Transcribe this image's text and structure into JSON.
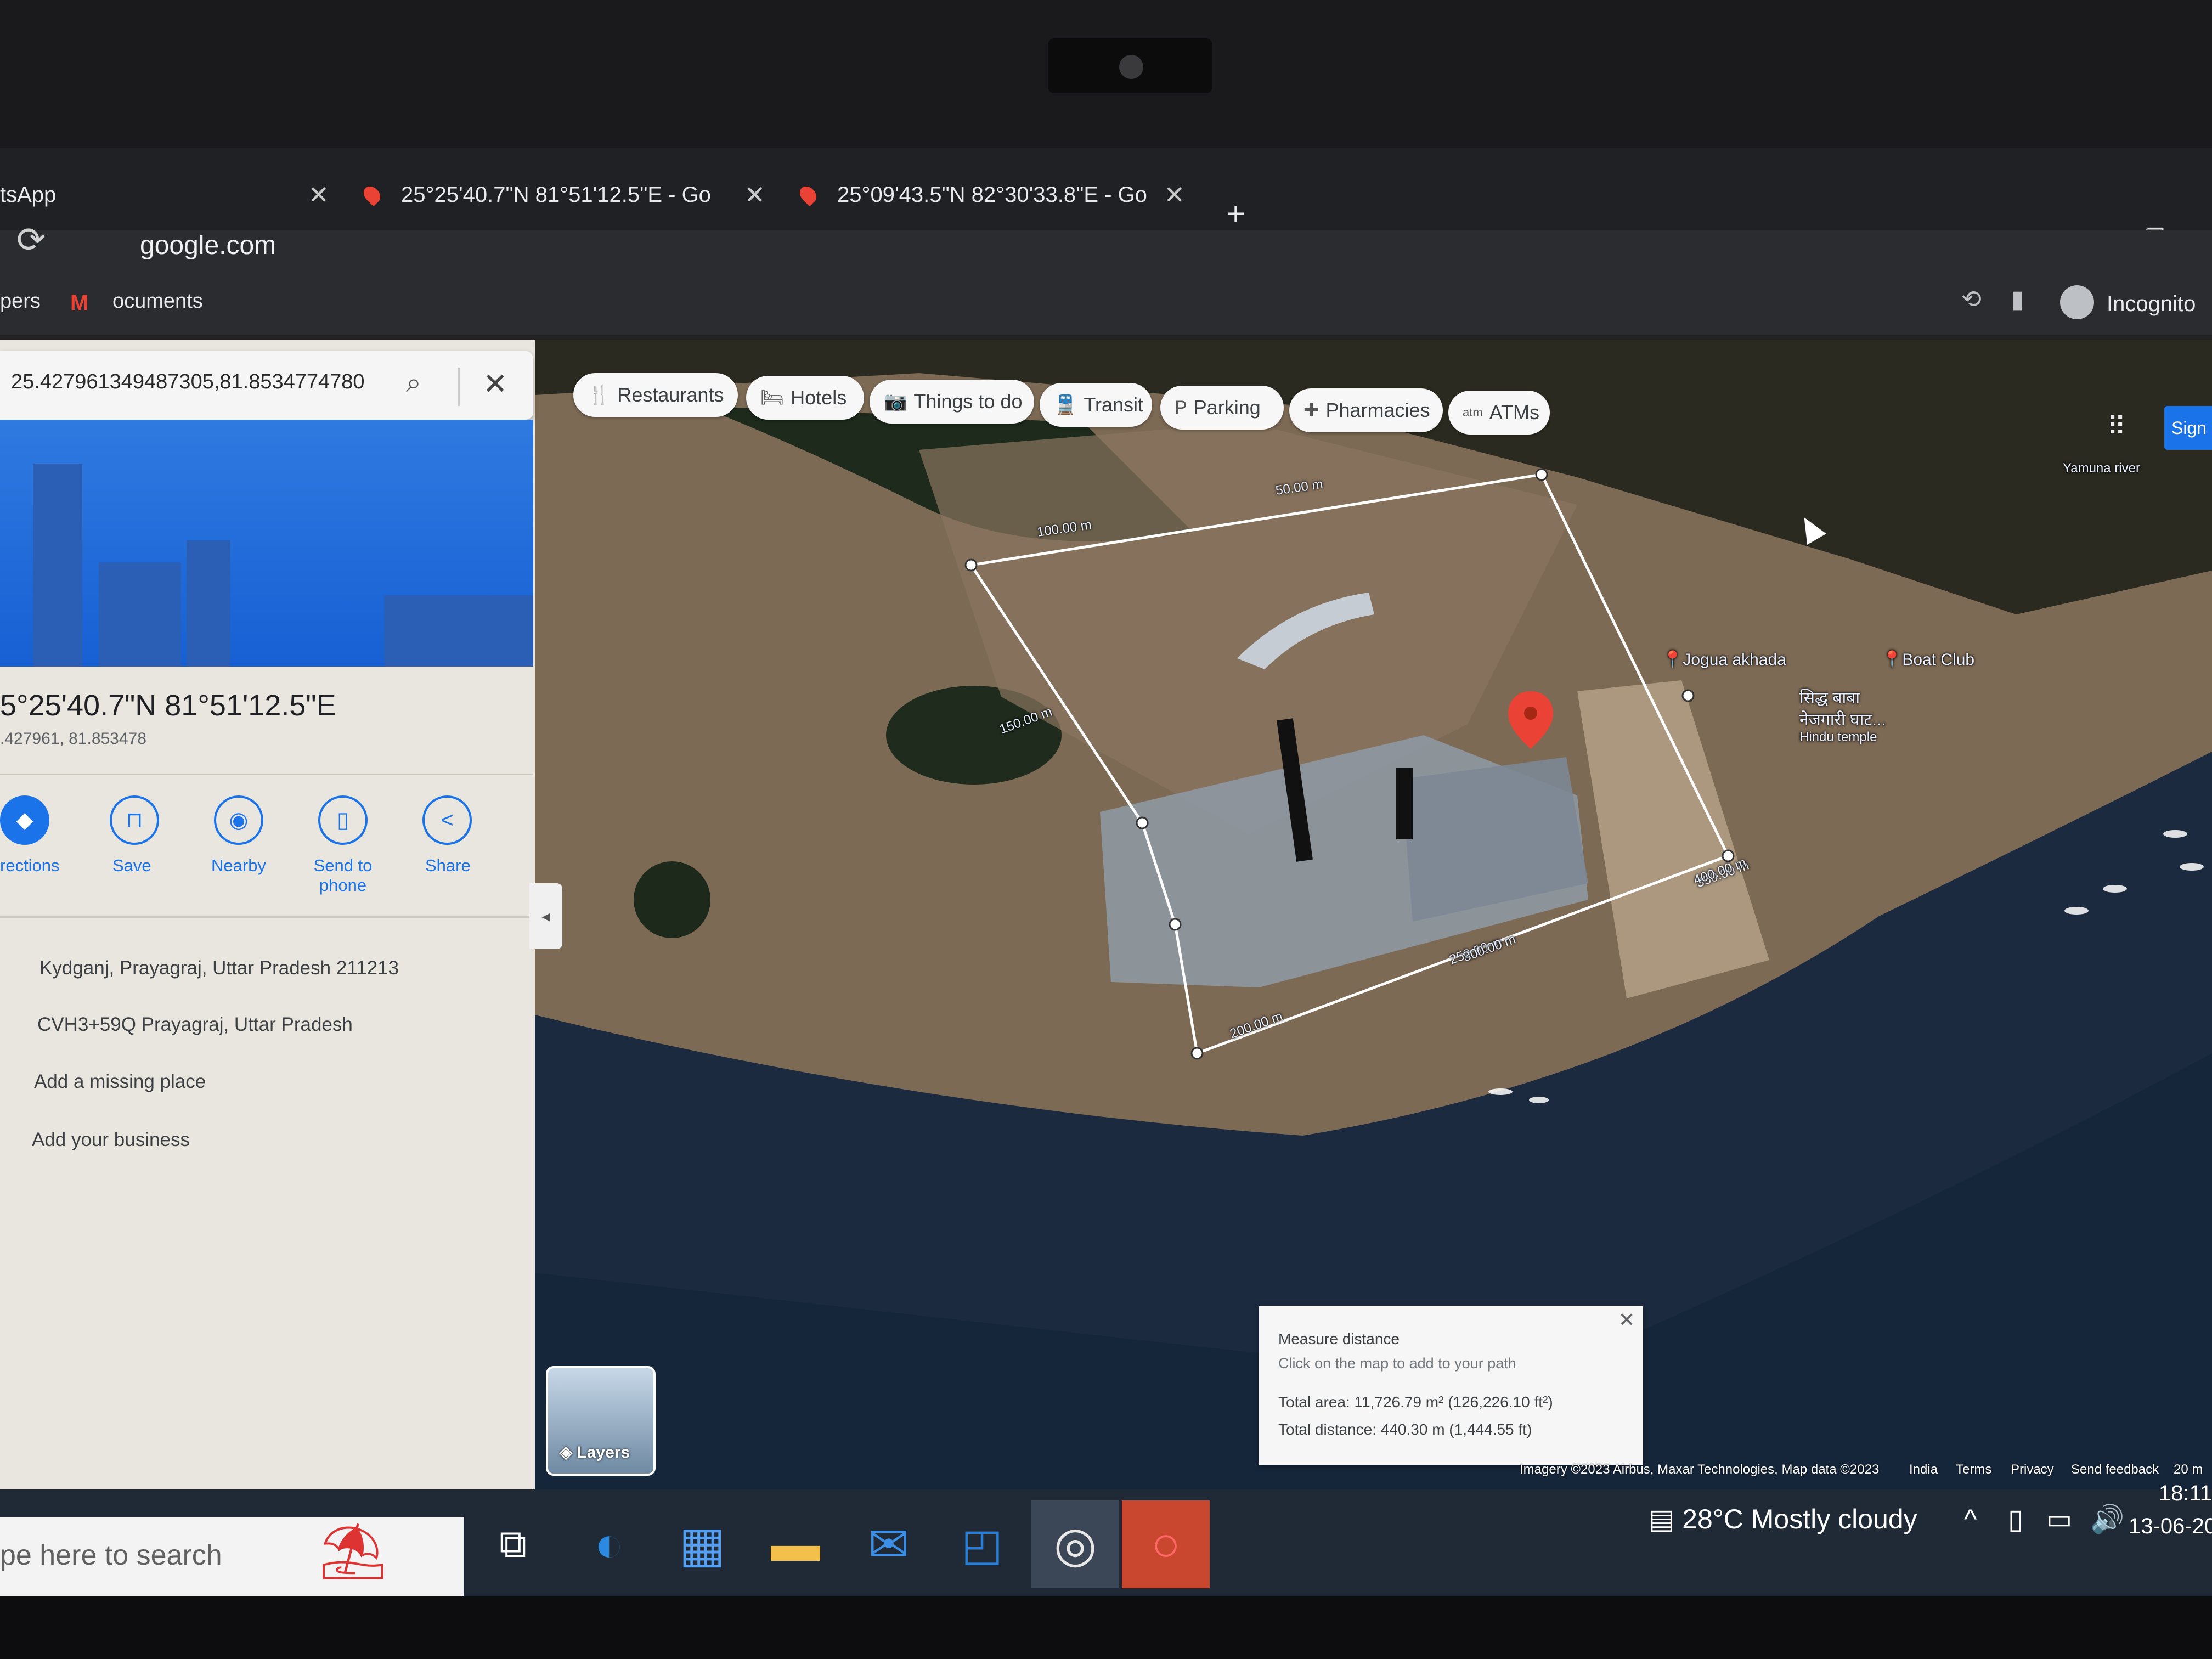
{
  "browser": {
    "tabs": [
      {
        "label": "tsApp"
      },
      {
        "label": "25°25'40.7\"N 81°51'12.5\"E - Go"
      },
      {
        "label": "25°09'43.5\"N 82°30'33.8\"E - Go"
      }
    ],
    "new_tab": "+",
    "url": "google.com",
    "bookmarks": {
      "left": "pers",
      "docs": "ocuments"
    },
    "profile_label": "Incognito",
    "window_controls": [
      "–",
      "❐"
    ]
  },
  "side_panel": {
    "search_value": "25.427961349487305,81.8534774780",
    "place_title": "5°25'40.7\"N 81°51'12.5\"E",
    "place_coords": ".427961, 81.853478",
    "actions": [
      {
        "label": "rections",
        "icon": "directions-icon"
      },
      {
        "label": "Save",
        "icon": "bookmark-icon"
      },
      {
        "label": "Nearby",
        "icon": "nearby-icon"
      },
      {
        "label": "Send to phone",
        "icon": "send-to-phone-icon"
      },
      {
        "label": "Share",
        "icon": "share-icon"
      }
    ],
    "address": "Kydganj, Prayagraj, Uttar Pradesh 211213",
    "plus_code": "CVH3+59Q Prayagraj, Uttar Pradesh",
    "add_missing": "Add a missing place",
    "add_business": "Add your business"
  },
  "map": {
    "chips": [
      {
        "label": "Restaurants",
        "icon": "🍴"
      },
      {
        "label": "Hotels",
        "icon": "🛏"
      },
      {
        "label": "Things to do",
        "icon": "📷"
      },
      {
        "label": "Transit",
        "icon": "🚆"
      },
      {
        "label": "Parking",
        "icon": "P"
      },
      {
        "label": "Pharmacies",
        "icon": "✚"
      },
      {
        "label": "ATMs",
        "icon": "atm"
      }
    ],
    "sign_in": "Sign",
    "measure_labels": [
      "100.00 m",
      "50.00 m",
      "150.00 m",
      "200.00 m",
      "250.00 m",
      "300.00 m",
      "350.00 m",
      "400.00 m"
    ],
    "pois": [
      {
        "label": "Jogua akhada"
      },
      {
        "label": "Boat Club"
      },
      {
        "label": "सिद्ध बाबा"
      },
      {
        "label": "नेजगारी घाट..."
      },
      {
        "label": "Hindu temple"
      },
      {
        "label": "Yamuna river"
      }
    ],
    "layers_label": "Layers",
    "measure_box": {
      "title": "Measure distance",
      "hint": "Click on the map to add to your path",
      "area": "Total area: 11,726.79 m² (126,226.10 ft²)",
      "distance": "Total distance: 440.30 m (1,444.55 ft)"
    },
    "footer": {
      "imagery": "Imagery ©2023 Airbus, Maxar Technologies, Map data ©2023",
      "country": "India",
      "terms": "Terms",
      "privacy": "Privacy",
      "feedback": "Send feedback",
      "scale": "20 m"
    }
  },
  "taskbar": {
    "search_placeholder": "pe here to search",
    "weather": "28°C  Mostly cloudy",
    "time": "18:11",
    "date": "13-06-20"
  }
}
